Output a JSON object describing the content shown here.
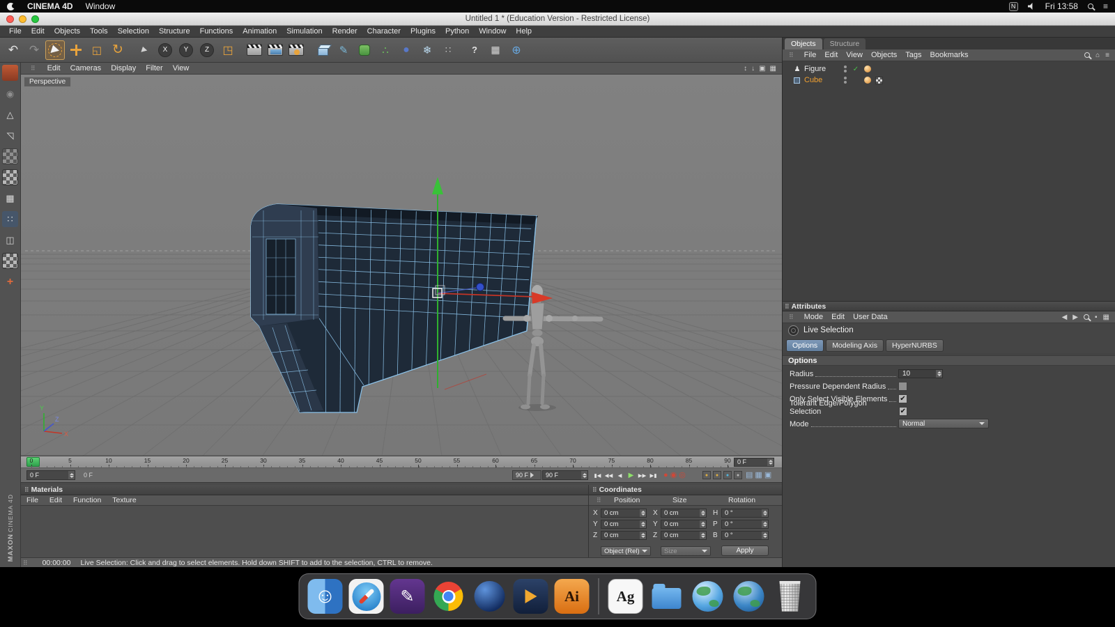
{
  "macos": {
    "app_name": "CINEMA 4D",
    "window_menu": "Window",
    "n_badge": "N",
    "clock": "Fri 13:58"
  },
  "titlebar": {
    "title": "Untitled 1 * (Education Version - Restricted License)"
  },
  "menus": {
    "items": [
      "File",
      "Edit",
      "Objects",
      "Tools",
      "Selection",
      "Structure",
      "Functions",
      "Animation",
      "Simulation",
      "Render",
      "Character",
      "Plugins",
      "Python",
      "Window",
      "Help"
    ]
  },
  "toolbar": {
    "axis_x": "X",
    "axis_y": "Y",
    "axis_z": "Z",
    "help": "?"
  },
  "icons": {
    "undo": "↶",
    "redo": "↷",
    "rotate": "↻",
    "scale": "◱",
    "coord": "◳",
    "pen": "✎",
    "array": "∴",
    "metaball": "●",
    "particles": "❄",
    "extras": "∷",
    "layout": "▦",
    "globe": "⊕",
    "camera": "◉",
    "triangle": "△",
    "corner": "◹",
    "objgrid": "▦",
    "points": "∷",
    "edge": "◫",
    "axisplus": "+",
    "house": "⌂",
    "menu": "≡",
    "updown": "↕",
    "down": "↓",
    "pane1": "▣",
    "pane2": "▦",
    "jump_start": "▮◀",
    "step_back": "◀◀",
    "play_back": "◀",
    "play": "▶",
    "step_fwd": "▶▶",
    "jump_end": "▶▮",
    "rec1": "●",
    "rec2": "◉",
    "rec3": "◎",
    "keydot": "●",
    "grid1": "▤",
    "grid2": "▦",
    "grid3": "▣",
    "figure_obj": "♟",
    "nav_left": "◀",
    "nav_right": "▶",
    "pin": "▪"
  },
  "viewport": {
    "menus": [
      "Edit",
      "Cameras",
      "Display",
      "Filter",
      "View"
    ],
    "camera_label": "Perspective",
    "axis_labels": {
      "x": "X",
      "y": "Y",
      "z": "Z"
    }
  },
  "timeline": {
    "ticks": [
      "0",
      "5",
      "10",
      "15",
      "20",
      "25",
      "30",
      "35",
      "40",
      "45",
      "50",
      "55",
      "60",
      "65",
      "70",
      "75",
      "80",
      "85",
      "90"
    ],
    "ruler_frame_field": "0 F",
    "current_frame_field": "0 F",
    "range_start_label": "0 F",
    "range_end_label": "90 F",
    "end_frame_field": "90 F"
  },
  "materials": {
    "title": "Materials",
    "menus": [
      "File",
      "Edit",
      "Function",
      "Texture"
    ]
  },
  "coordinates": {
    "title": "Coordinates",
    "headers": [
      "Position",
      "Size",
      "Rotation"
    ],
    "position": {
      "x_label": "X",
      "x": "0 cm",
      "y_label": "Y",
      "y": "0 cm",
      "z_label": "Z",
      "z": "0 cm"
    },
    "size": {
      "x_label": "X",
      "x": "0 cm",
      "y_label": "Y",
      "y": "0 cm",
      "z_label": "Z",
      "z": "0 cm"
    },
    "rotation": {
      "h_label": "H",
      "h": "0 °",
      "p_label": "P",
      "p": "0 °",
      "b_label": "B",
      "b": "0 °"
    },
    "object_mode": "Object (Rel)",
    "size_mode": "Size",
    "apply": "Apply"
  },
  "status": {
    "time": "00:00:00",
    "message": "Live Selection: Click and drag to select elements. Hold down SHIFT to add to the selection, CTRL to remove."
  },
  "object_manager": {
    "tabs": [
      "Objects",
      "Structure"
    ],
    "menus": [
      "File",
      "Edit",
      "View",
      "Objects",
      "Tags",
      "Bookmarks"
    ],
    "objects": [
      {
        "name": "Figure"
      },
      {
        "name": "Cube"
      }
    ],
    "enabled_glyph": "✓"
  },
  "attributes": {
    "title": "Attributes",
    "menus": [
      "Mode",
      "Edit",
      "User Data"
    ],
    "tool": "Live Selection",
    "tabs": [
      "Options",
      "Modeling Axis",
      "HyperNURBS"
    ],
    "section": "Options",
    "radius_label": "Radius",
    "radius_value": "10",
    "pressure_label": "Pressure Dependent Radius",
    "visible_label": "Only Select Visible Elements",
    "tolerant_label": "Tolerant Edge/Polygon Selection",
    "mode_label": "Mode",
    "mode_value": "Normal",
    "checked_glyph": "✔"
  },
  "branding": {
    "maxon": "MAXON",
    "cinema": "CINEMA 4D"
  },
  "dock": {
    "ai": "Ai",
    "ag": "Ag"
  }
}
